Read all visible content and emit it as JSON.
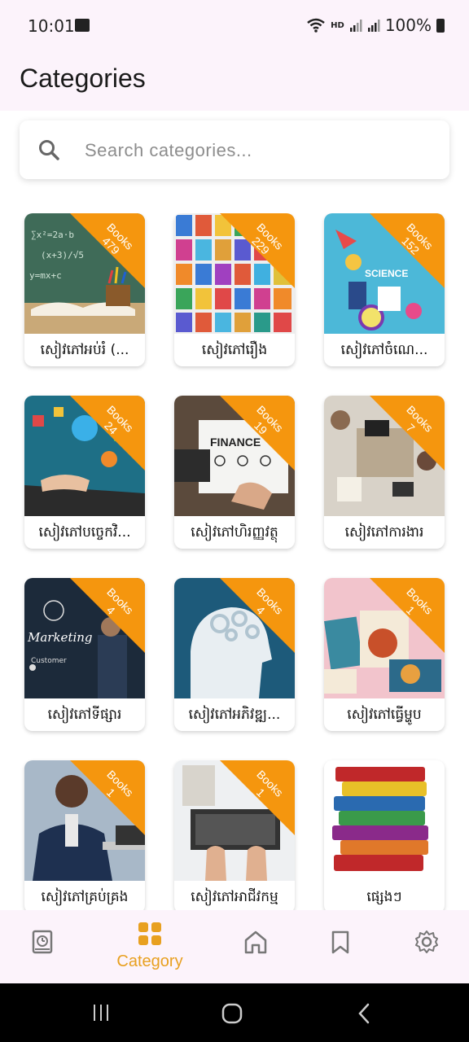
{
  "status": {
    "time": "10:01",
    "network": "HD",
    "battery": "100%"
  },
  "header": {
    "title": "Categories"
  },
  "search": {
    "placeholder": "Search categories..."
  },
  "categories": [
    {
      "name": "សៀវភៅអប់រំ (...",
      "count_label": "Books\n479"
    },
    {
      "name": "សៀវភៅរឿង",
      "count_label": "Books\n229"
    },
    {
      "name": "សៀវភៅចំណេ...",
      "count_label": "Books\n152"
    },
    {
      "name": "សៀវភៅបច្ចេកវិ...",
      "count_label": "Books\n24"
    },
    {
      "name": "សៀវភៅហិរញ្ញវត្ថុ",
      "count_label": "Books\n19"
    },
    {
      "name": "សៀវភៅការងារ",
      "count_label": "Books\n7"
    },
    {
      "name": "សៀវភៅទីផ្សារ",
      "count_label": "Books\n4"
    },
    {
      "name": "សៀវភៅអភិវឌ្ឍ...",
      "count_label": "Books\n4"
    },
    {
      "name": "សៀវភៅធ្វើម្ហូប",
      "count_label": "Books\n1"
    },
    {
      "name": "សៀវភៅគ្រប់គ្រង",
      "count_label": "Books\n1"
    },
    {
      "name": "សៀវភៅអាជីវកម្ម",
      "count_label": "Books\n1"
    },
    {
      "name": "ផ្សេងៗ",
      "count_label": ""
    }
  ],
  "nav": {
    "category_label": "Category"
  },
  "colors": {
    "accent": "#f5960e",
    "background": "#fcf3fb"
  }
}
